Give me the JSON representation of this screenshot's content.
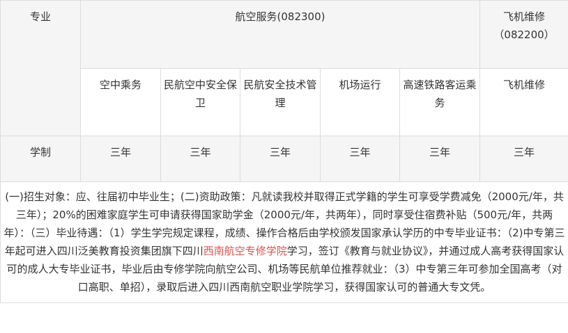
{
  "header": {
    "col_label": "专业",
    "group_label": "航空服务(082300)",
    "aircraft_label": "飞机维修",
    "aircraft_code": "（082200）"
  },
  "subheaders": [
    "空中乘务",
    "民航空中安全保卫",
    "民航安全技术管理",
    "机场运行",
    "高速铁路客运乘务",
    "飞机维修"
  ],
  "duration_row": {
    "label": "学制",
    "values": [
      "三年",
      "三年",
      "三年",
      "三年",
      "三年",
      "三年"
    ]
  },
  "notes": {
    "part1": "(一)招生对象：应、往届初中毕业生；(二)资助政策：凡就读我校并取得正式学籍的学生可享受学费减免（2000元/年，共三年）；20%的困难家庭学生可申请获得国家助学金（2000元/年，共两年），同时享受住宿费补贴（500元/年，共两年）：（三）毕业待遇：（1）学生学完规定课程，成绩、操作合格后由学校颁发国家承认学历的中专毕业证书：（2)中专第三年起可进入四川泛美教育投资集团旗下四川",
    "link": "西南航空专修学院",
    "part2": "学习，签订《教育与就业协议》，并通过成人高考获得国家认可的成人大专毕业证书，毕业后由专修学院向航空公司、机场等民航单位推荐就业：（3）中专第三年可参加全国高考（对口高职、单招），录取后进入四川西南航空职业学院学习，获得国家认可的普通大专文凭。"
  }
}
